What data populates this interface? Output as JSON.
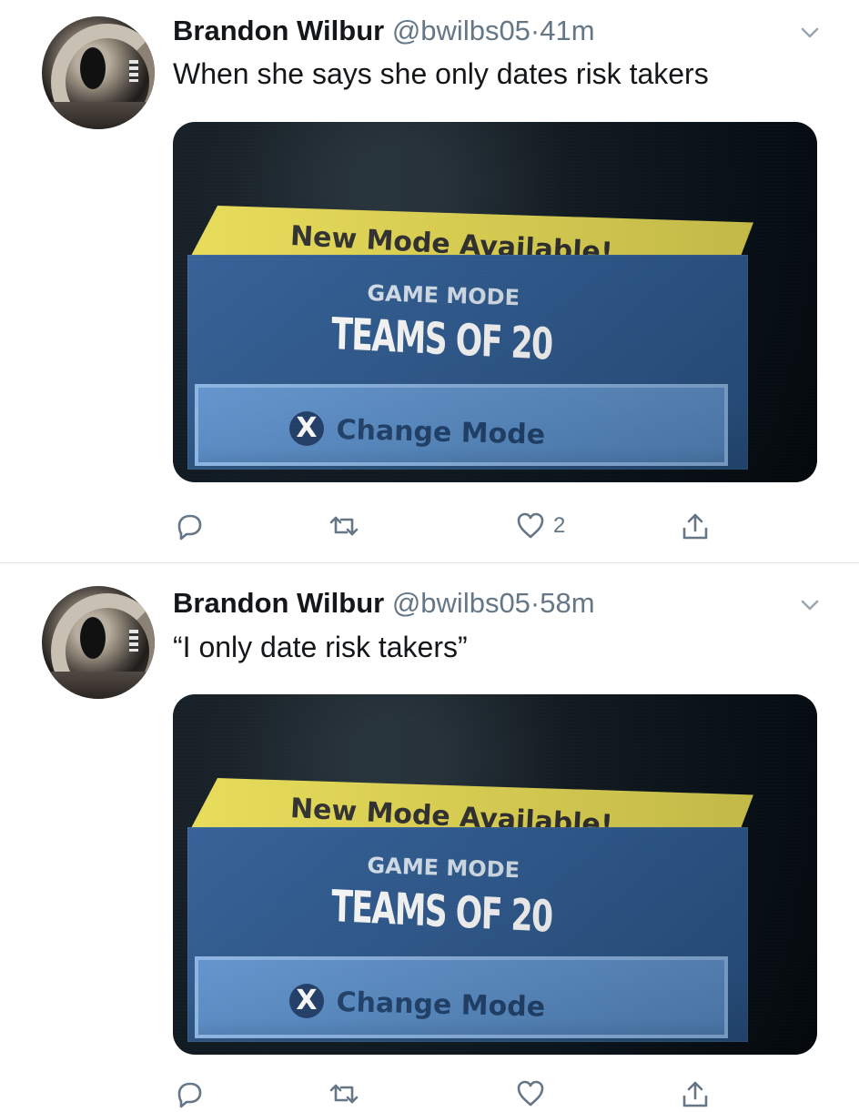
{
  "tweets": [
    {
      "author": "Brandon Wilbur",
      "handle": "@bwilbs05",
      "separator": "·",
      "time": "41m",
      "text": "When she says she only dates risk takers",
      "media": {
        "banner_title": "New Mode Available!",
        "game_mode_label": "GAME MODE",
        "mode_name": "TEAMS OF 20",
        "button_icon": "X",
        "button_label": "Change Mode"
      },
      "actions": {
        "reply_icon": "reply-icon",
        "retweet_icon": "retweet-icon",
        "like_icon": "heart-icon",
        "like_count": "2",
        "share_icon": "share-icon"
      }
    },
    {
      "author": "Brandon Wilbur",
      "handle": "@bwilbs05",
      "separator": "·",
      "time": "58m",
      "text": "“I only date risk takers”",
      "media": {
        "banner_title": "New Mode Available!",
        "game_mode_label": "GAME MODE",
        "mode_name": "TEAMS OF 20",
        "button_icon": "X",
        "button_label": "Change Mode"
      },
      "actions": {
        "reply_icon": "reply-icon",
        "retweet_icon": "retweet-icon",
        "like_icon": "heart-icon",
        "like_count": "",
        "share_icon": "share-icon"
      }
    }
  ],
  "colors": {
    "text_primary": "#14171a",
    "text_secondary": "#657786",
    "divider": "#dfe3e8",
    "yellow_banner": "#e8dc54",
    "mode_panel": "#2f5d95",
    "mode_button": "#5f92cc"
  }
}
